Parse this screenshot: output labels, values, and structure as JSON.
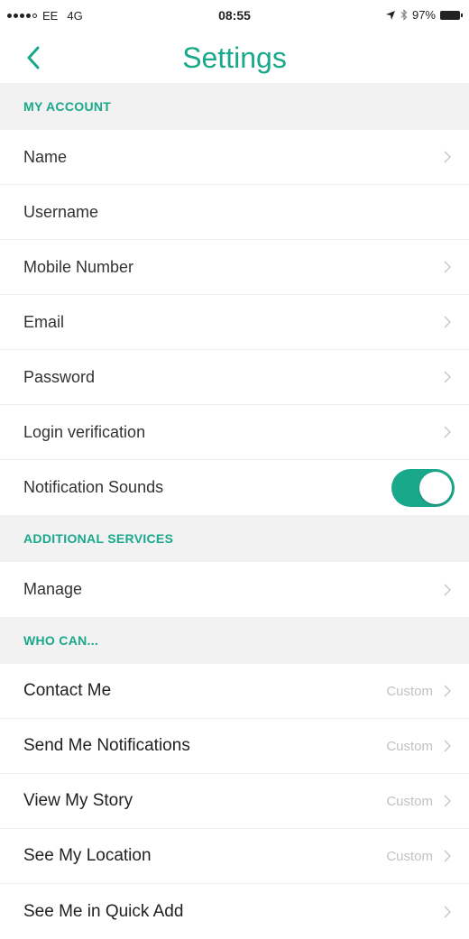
{
  "status": {
    "carrier": "EE",
    "network": "4G",
    "time": "08:55",
    "battery": "97%"
  },
  "nav": {
    "title": "Settings"
  },
  "sections": {
    "my_account": {
      "header": "MY ACCOUNT",
      "items": [
        "Name",
        "Username",
        "Mobile Number",
        "Email",
        "Password",
        "Login verification",
        "Notification Sounds"
      ]
    },
    "additional_services": {
      "header": "ADDITIONAL SERVICES",
      "items": [
        "Manage"
      ]
    },
    "who_can": {
      "header": "WHO CAN...",
      "items": [
        {
          "label": "Contact Me",
          "value": "Custom"
        },
        {
          "label": "Send Me Notifications",
          "value": "Custom"
        },
        {
          "label": "View My Story",
          "value": "Custom"
        },
        {
          "label": "See My Location",
          "value": "Custom"
        },
        {
          "label": "See Me in Quick Add",
          "value": ""
        }
      ]
    }
  },
  "toggles": {
    "notification_sounds": true
  },
  "colors": {
    "accent": "#1aa88b",
    "section_bg": "#f2f2f2",
    "muted": "#c2c2c2"
  },
  "icons": [
    "back-chevron-icon",
    "chevron-right-icon",
    "location-arrow-icon",
    "bluetooth-icon",
    "battery-icon"
  ]
}
